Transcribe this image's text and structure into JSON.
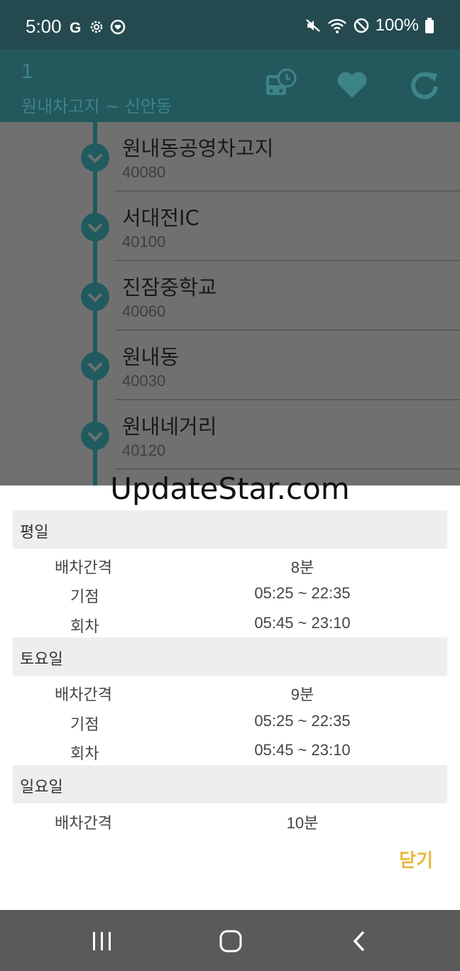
{
  "status_bar": {
    "time": "5:00",
    "battery": "100%",
    "left_icons": [
      "google-icon",
      "settings-icon",
      "heart-monitor-icon"
    ],
    "right_icons": [
      "mute-icon",
      "wifi-icon",
      "do-not-disturb-icon",
      "battery-icon"
    ]
  },
  "app_bar": {
    "route_number": "1",
    "route_name": "원내차고지 ~ 신안동",
    "actions": [
      "bus-schedule-icon",
      "favorite-heart-icon",
      "refresh-icon"
    ]
  },
  "stops": [
    {
      "name": "원내동공영차고지",
      "code": "40080"
    },
    {
      "name": "서대전IC",
      "code": "40100"
    },
    {
      "name": "진잠중학교",
      "code": "40060"
    },
    {
      "name": "원내동",
      "code": "40030"
    },
    {
      "name": "원내네거리",
      "code": "40120"
    }
  ],
  "watermark": "UpdateStar.com",
  "schedule": {
    "weekday": {
      "title": "평일",
      "interval_label": "배차간격",
      "interval_value": "8분",
      "start_label": "기점",
      "start_value": "05:25 ~ 22:35",
      "return_label": "회차",
      "return_value": "05:45 ~ 23:10"
    },
    "saturday": {
      "title": "토요일",
      "interval_label": "배차간격",
      "interval_value": "9분",
      "start_label": "기점",
      "start_value": "05:25 ~ 22:35",
      "return_label": "회차",
      "return_value": "05:45 ~ 23:10"
    },
    "sunday": {
      "title": "일요일",
      "interval_label": "배차간격",
      "interval_value": "10분"
    },
    "close_label": "닫기"
  },
  "colors": {
    "status_bar": "#244a4f",
    "app_bar": "#23595c",
    "timeline": "#1f5b5f",
    "close_accent": "#e8b93a"
  }
}
